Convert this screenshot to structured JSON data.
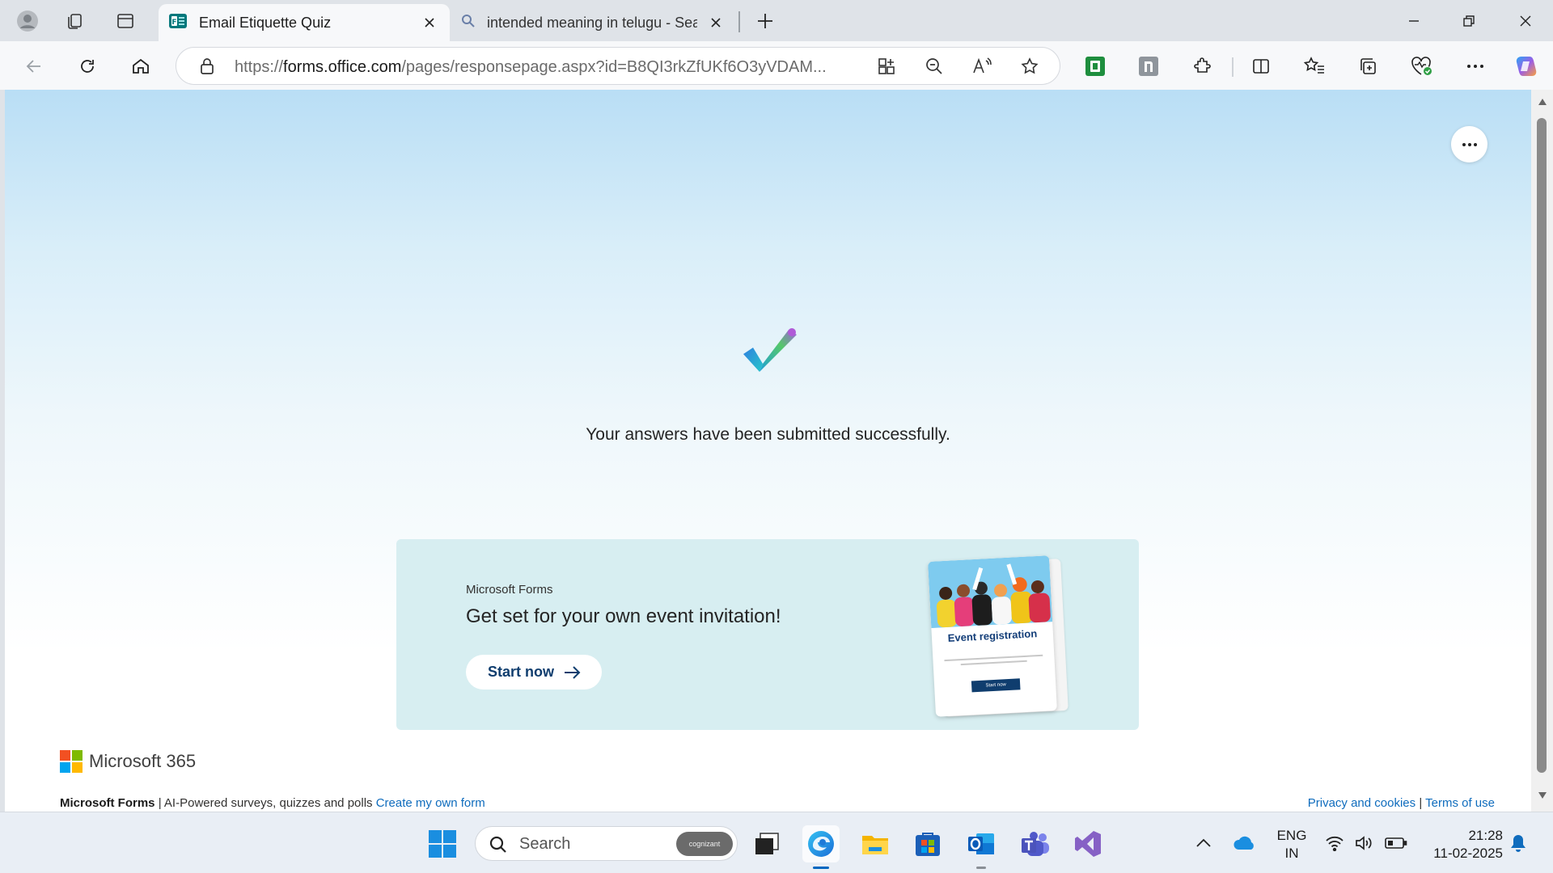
{
  "browser": {
    "tabs": [
      {
        "title": "Email Etiquette Quiz",
        "active": true
      },
      {
        "title": "intended meaning in telugu - Sea",
        "active": false
      }
    ],
    "url_prefix": "https://",
    "url_domain": "forms.office.com",
    "url_path": "/pages/responsepage.aspx?id=B8QI3rkZfUKf6O3yVDAM..."
  },
  "page": {
    "success_message": "Your answers have been submitted successfully.",
    "promo": {
      "small_label": "Microsoft Forms",
      "title": "Get set for your own event invitation!",
      "button": "Start now",
      "card_title": "Event registration",
      "card_button": "Start now"
    },
    "brand": "Microsoft 365",
    "footer": {
      "product": "Microsoft Forms",
      "tagline": "| AI-Powered surveys, quizzes and polls",
      "create_link": "Create my own form",
      "privacy_link": "Privacy and cookies",
      "separator": "|",
      "terms_link": "Terms of use"
    }
  },
  "taskbar": {
    "search_label": "Search",
    "search_badge": "cognizant",
    "language_line1": "ENG",
    "language_line2": "IN",
    "time": "21:28",
    "date": "11-02-2025"
  },
  "colors": {
    "accent": "#0f6cbd",
    "promo_bg": "#d7eef1",
    "button_text": "#0f3d6e"
  }
}
